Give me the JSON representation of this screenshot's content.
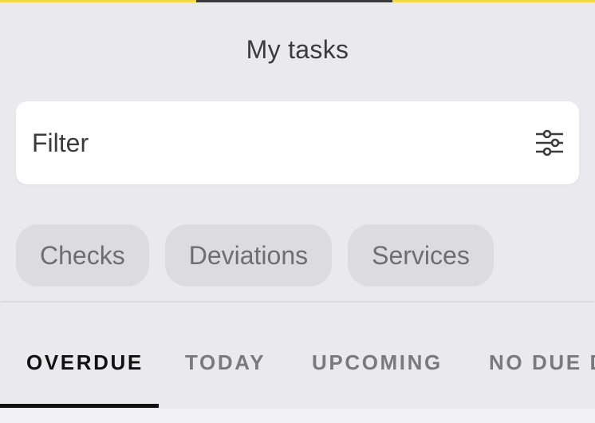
{
  "header": {
    "title": "My tasks"
  },
  "filter": {
    "placeholder": "Filter",
    "icon": "sliders-icon"
  },
  "chips": [
    {
      "label": "Checks"
    },
    {
      "label": "Deviations"
    },
    {
      "label": "Services"
    }
  ],
  "tabs": [
    {
      "label": "OVERDUE",
      "selected": true
    },
    {
      "label": "TODAY",
      "selected": false
    },
    {
      "label": "UPCOMING",
      "selected": false
    },
    {
      "label": "NO DUE D",
      "selected": false
    }
  ],
  "colors": {
    "accent_strip": "#f4d84a",
    "background": "#e9e9ee",
    "chip_background": "#dcdcdf",
    "active_tab": "#111111"
  }
}
